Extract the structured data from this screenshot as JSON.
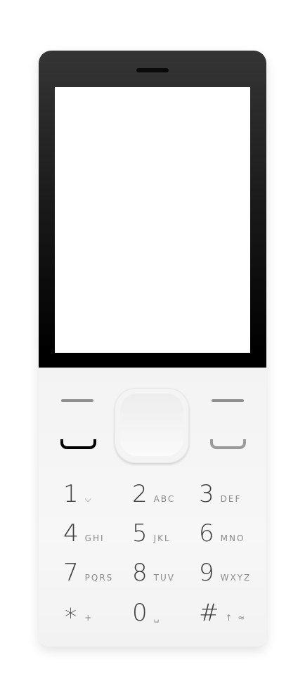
{
  "device": "feature-phone",
  "keys": [
    {
      "digit": "1",
      "letters": "⌵"
    },
    {
      "digit": "2",
      "letters": "ABC"
    },
    {
      "digit": "3",
      "letters": "DEF"
    },
    {
      "digit": "4",
      "letters": "GHI"
    },
    {
      "digit": "5",
      "letters": "JKL"
    },
    {
      "digit": "6",
      "letters": "MNO"
    },
    {
      "digit": "7",
      "letters": "PQRS"
    },
    {
      "digit": "8",
      "letters": "TUV"
    },
    {
      "digit": "9",
      "letters": "WXYZ"
    },
    {
      "digit": "∗",
      "letters": "+"
    },
    {
      "digit": "0",
      "letters": "␣"
    },
    {
      "digit": "#",
      "letters": "↑ ≈"
    }
  ],
  "colors": {
    "body_top": "#353535",
    "keypad": "#f4f4f4",
    "call_key": "#000000",
    "end_key": "#9a9a9a"
  }
}
